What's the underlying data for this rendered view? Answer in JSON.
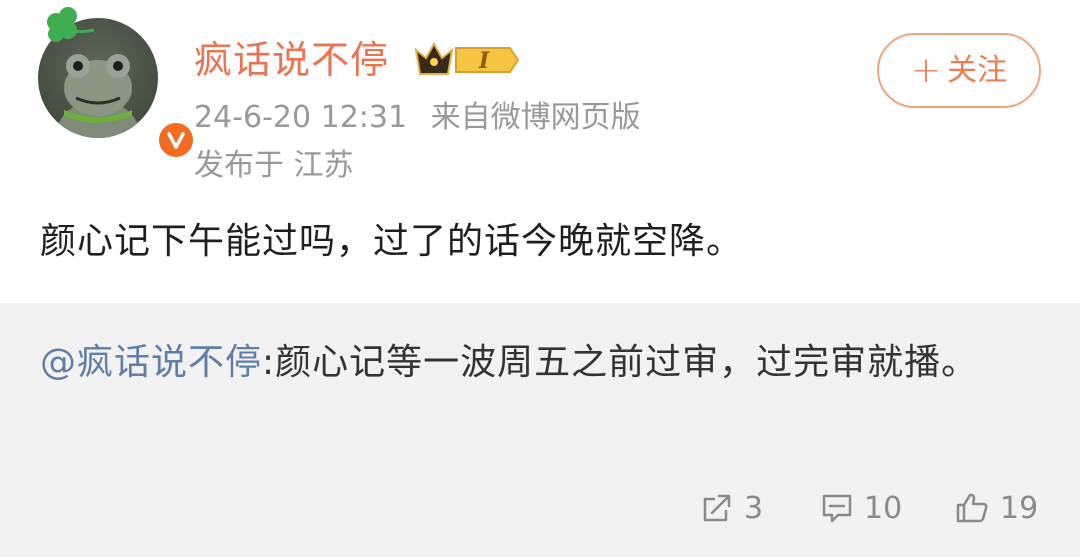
{
  "post": {
    "username": "疯话说不停",
    "level_badge": "I",
    "time": "24-6-20 12:31",
    "source": "来自微博网页版",
    "location": "发布于 江苏",
    "follow_label": "关注",
    "follow_plus": "+",
    "text": "颜心记下午能过吗，过了的话今晚就空降。"
  },
  "repost": {
    "mention": "@疯话说不停",
    "text": ":颜心记等一波周五之前过审，过完审就播。"
  },
  "actions": {
    "share_count": "3",
    "comment_count": "10",
    "like_count": "19"
  },
  "colors": {
    "username": "#eb7350",
    "mention": "#5f7ea8",
    "follow": "#f07c4c",
    "verified": "#f26d1f",
    "meta": "#999999",
    "repost_bg": "#f2f2f2"
  },
  "icons": {
    "avatar": "frog-avatar",
    "decoration": "clover-icon",
    "verified": "verified-v-icon",
    "level": "crown-level-badge-icon",
    "share": "share-icon",
    "comment": "comment-icon",
    "like": "thumbs-up-icon"
  }
}
